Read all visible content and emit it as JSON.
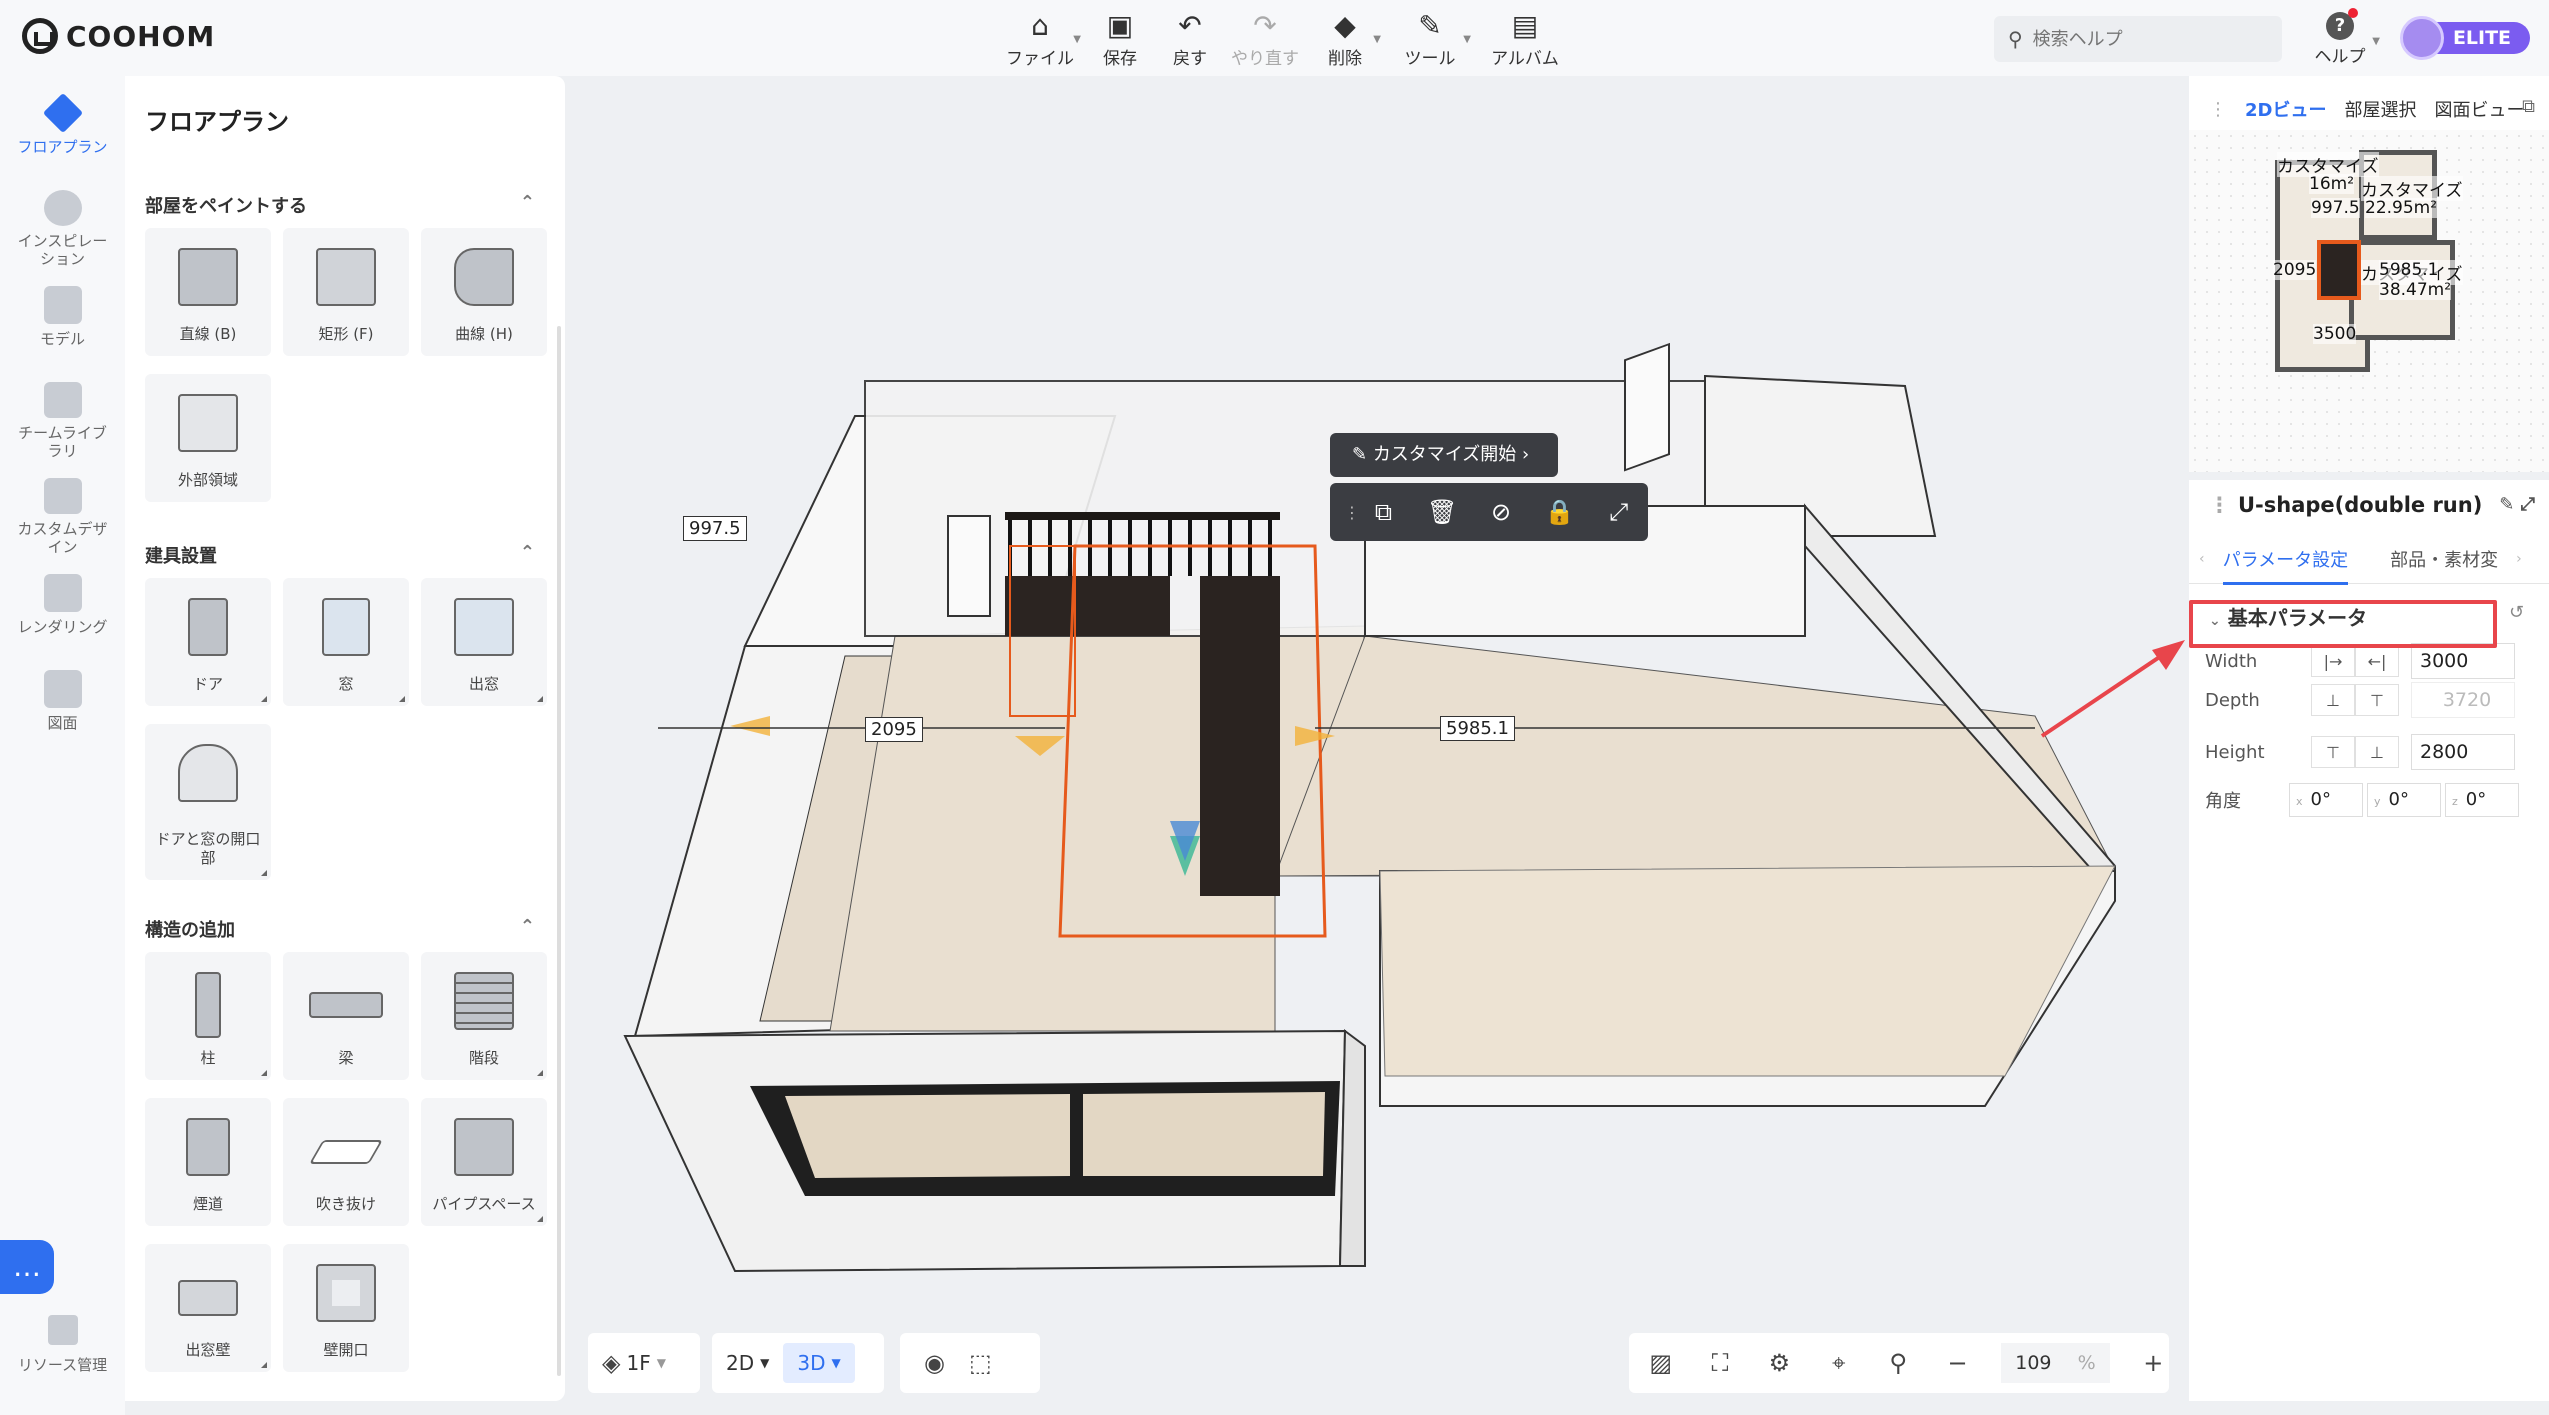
{
  "app": {
    "logo_text": "COOHOM"
  },
  "toolbar": {
    "file": "ファイル",
    "save": "保存",
    "undo": "戻す",
    "redo": "やり直す",
    "delete": "削除",
    "tools": "ツール",
    "album": "アルバム"
  },
  "search": {
    "placeholder": "検索ヘルプ"
  },
  "help": {
    "label": "ヘルプ"
  },
  "user": {
    "badge": "ELITE"
  },
  "leftnav": {
    "floorplan": "フロアプラン",
    "inspiration": "インスピレーション",
    "model": "モデル",
    "team_library": "チームライブラリ",
    "custom_design": "カスタムデザイン",
    "rendering": "レンダリング",
    "drawing": "図面",
    "resource": "リソース管理"
  },
  "panel": {
    "title": "フロアプラン",
    "paint_room": {
      "header": "部屋をペイントする",
      "items": [
        "直線 (B)",
        "矩形 (F)",
        "曲線 (H)",
        "外部領域"
      ]
    },
    "fixtures": {
      "header": "建具設置",
      "items": [
        "ドア",
        "窓",
        "出窓",
        "ドアと窓の開口部"
      ]
    },
    "structure": {
      "header": "構造の追加",
      "items": [
        "柱",
        "梁",
        "階段",
        "煙道",
        "吹き抜け",
        "パイプスペース",
        "出窓壁",
        "壁開口"
      ]
    }
  },
  "canvas": {
    "dims": {
      "top": "997.5",
      "left": "2095",
      "right": "5985.1"
    },
    "context": {
      "start_custom": "カスタマイズ開始"
    }
  },
  "bottom": {
    "floor": "1F",
    "view2d": "2D",
    "view3d": "3D"
  },
  "zoom": {
    "value": "109",
    "unit": "%"
  },
  "right": {
    "tabs": [
      "2Dビュー",
      "部屋選択",
      "図面ビュー"
    ],
    "minimap": {
      "room1": "カスタマイズ",
      "room1_area": "16m²",
      "room2": "カスタマイズ",
      "room2_area": "22.95m²",
      "room3": "カスタマイズ",
      "room3_area": "38.47m²",
      "d1": "997.5",
      "d2": "2095",
      "d3": "5985.1",
      "d4": "3500"
    },
    "object_title": "U-shape(double run)",
    "subtabs": [
      "パラメータ設定",
      "部品・素材変"
    ],
    "group": "基本パラメータ",
    "params": {
      "width_label": "Width",
      "width": "3000",
      "depth_label": "Depth",
      "depth": "3720",
      "height_label": "Height",
      "height": "2800",
      "angle_label": "角度",
      "ax": "x",
      "ay": "y",
      "az": "z",
      "x": "0°",
      "y": "0°",
      "z": "0°"
    }
  },
  "colors": {
    "accent": "#2f6fef",
    "highlight": "#e8454b",
    "brand_badge": "#7b5cf0"
  }
}
